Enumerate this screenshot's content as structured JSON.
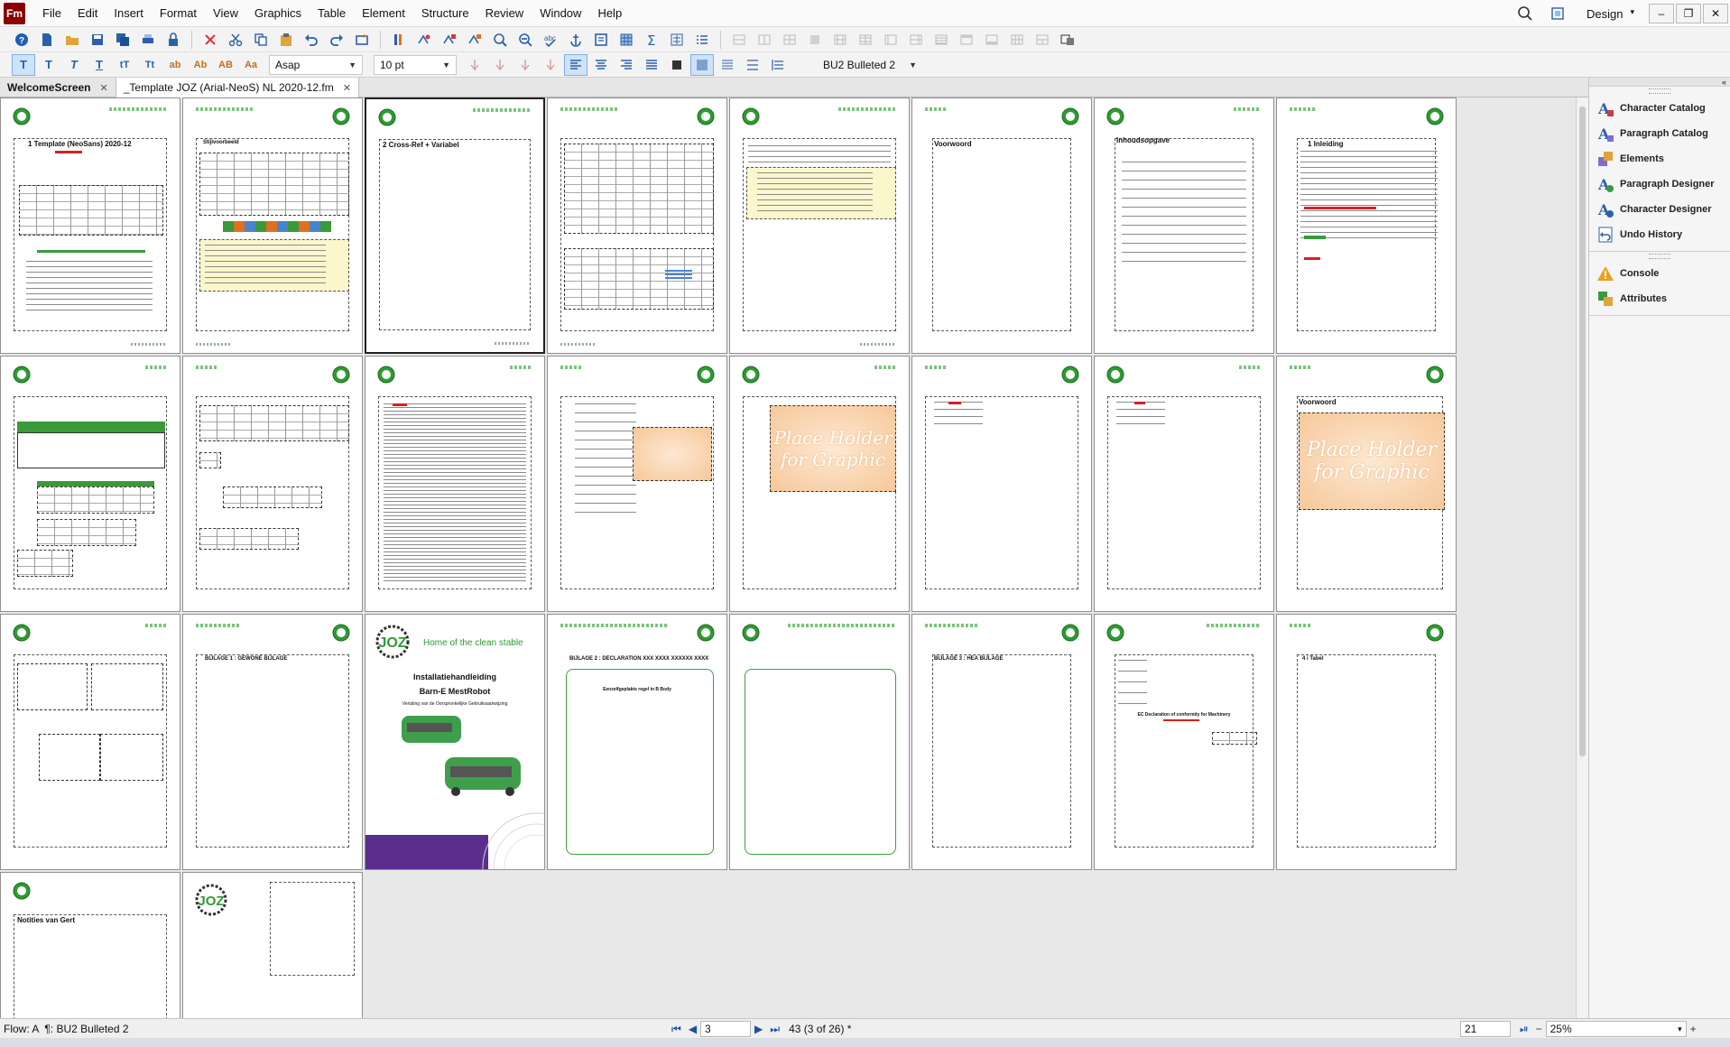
{
  "app": {
    "logo_text": "Fm"
  },
  "menubar": {
    "items": [
      "File",
      "Edit",
      "Insert",
      "Format",
      "View",
      "Graphics",
      "Table",
      "Element",
      "Structure",
      "Review",
      "Window",
      "Help"
    ],
    "workspace_label": "Design",
    "window_buttons": [
      "–",
      "❐",
      "✕"
    ]
  },
  "toolbar2": {
    "font_family": "Asap",
    "font_size": "10 pt",
    "paragraph_tag": "BU2 Bulleted 2",
    "text_style_labels": [
      "T",
      "T",
      "T",
      "T",
      "tT",
      "Tt",
      "ab",
      "Ab",
      "AB",
      "Aa"
    ]
  },
  "tabs": [
    {
      "label": "WelcomeScreen",
      "active": false
    },
    {
      "label": "_Template JOZ (Arial-NeoS) NL 2020-12.fm",
      "active": true
    }
  ],
  "pages": {
    "p1_title": "1 Template (NeoSans) 2020-12",
    "p2_title": "Stijlvoorbeeld",
    "p3_title": "2 Cross-Ref + Variabel",
    "p6_title": "Voorwoord",
    "p7_title": "Inhoudsopgave",
    "p8_title": "1 Inleiding",
    "p16_title": "Voorwoord",
    "p18_title": "BIJLAGE 1 : GEWONE BIJLAGE",
    "p19_brand": "Home of the clean stable",
    "p19_title1": "Installatiehandleiding",
    "p19_title2": "Barn-E MestRobot",
    "p19_subtitle": "Vertaling van de Oorspronkelijke Gebruiksaanwijzing",
    "p20_title": "BIJLAGE 2 : DECLARATION XXX XXXX XXXXXX XXXX",
    "p20_box_title": "Eenzelfgeplakte regel in B Body",
    "p22_title": "BIJLAGE 3 : HEA BIJLAGE",
    "p23_title": "EC Declaration of conformity for Machinery",
    "p24_title": "4 i Tabel",
    "p25_title": "Notities van Gert",
    "placeholder_text_1": "Place Holder",
    "placeholder_text_2": "for Graphic",
    "logo_text": "JOZ"
  },
  "rightpanel": {
    "group1": [
      "Character Catalog",
      "Paragraph Catalog",
      "Elements",
      "Paragraph Designer",
      "Character Designer",
      "Undo History"
    ],
    "group2": [
      "Console",
      "Attributes"
    ],
    "collapse_label": "«"
  },
  "statusbar": {
    "flow": "Flow: A",
    "paragraph_tag": "¶: BU2 Bulleted 2",
    "page_input": "3",
    "page_info": "43 (3 of 26) *",
    "field_value": "21",
    "zoom": "25%"
  },
  "colors": {
    "accent_green": "#2f9a33",
    "brand_purple": "#5b2e8e",
    "menu_red": "#8b0000"
  }
}
